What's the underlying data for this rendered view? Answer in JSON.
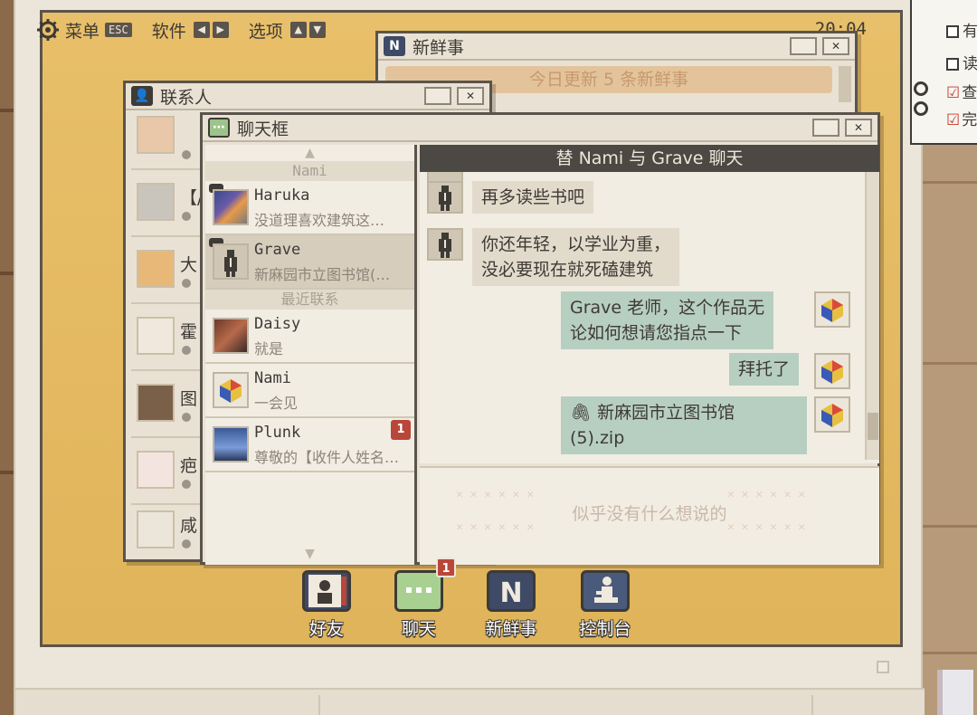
{
  "menubar": {
    "menu_label": "菜单",
    "esc_key": "ESC",
    "software_label": "软件",
    "options_label": "选项",
    "clock": "20:04"
  },
  "news_window": {
    "title": "新鲜事",
    "banner": "今日更新 5 条新鲜事"
  },
  "contacts_window": {
    "title": "联系人",
    "visible_name_fragments": [
      "【/",
      "大",
      "霍",
      "图",
      "疤",
      "咸"
    ]
  },
  "chat_window": {
    "title": "聊天框",
    "header": "替 Nami 与 Grave 聊天",
    "list": {
      "section_nami": "Nami",
      "section_recent": "最近联系",
      "items": [
        {
          "name": "Haruka",
          "preview": "没道理喜欢建筑这…",
          "badge": ""
        },
        {
          "name": "Grave",
          "preview": "新麻园市立图书馆(…",
          "badge": ""
        },
        {
          "name": "Daisy",
          "preview": "就是",
          "badge": ""
        },
        {
          "name": "Nami",
          "preview": "一会见",
          "badge": ""
        },
        {
          "name": "Plunk",
          "preview": "尊敬的【收件人姓名…",
          "badge": "1"
        }
      ]
    },
    "messages": [
      {
        "side": "in",
        "lines": [
          "再多读些书吧"
        ]
      },
      {
        "side": "in",
        "lines": [
          "你还年轻，以学业为重，",
          "没必要现在就死磕建筑"
        ]
      },
      {
        "side": "out",
        "lines": [
          "Grave 老师，这个作品无",
          "论如何想请您指点一下"
        ]
      },
      {
        "side": "out",
        "lines": [
          "拜托了"
        ]
      },
      {
        "side": "out",
        "lines": [
          "新麻园市立图书馆",
          "(5).zip"
        ]
      }
    ],
    "input_placeholder": "似乎没有什么想说的"
  },
  "dock": {
    "items": [
      {
        "label": "好友",
        "icon": "friends-icon",
        "badge": ""
      },
      {
        "label": "聊天",
        "icon": "chat-icon",
        "badge": "1"
      },
      {
        "label": "新鲜事",
        "icon": "news-icon",
        "badge": ""
      },
      {
        "label": "控制台",
        "icon": "console-icon",
        "badge": ""
      }
    ]
  },
  "todo": {
    "items": [
      {
        "text": "有",
        "checked": false
      },
      {
        "text": "读",
        "checked": false
      },
      {
        "text": "查",
        "checked": true
      },
      {
        "text": "完",
        "checked": true
      }
    ]
  },
  "colors": {
    "desktop": "#e3b865",
    "window_bg": "#e9e2d4",
    "frame": "#5a544c",
    "incoming_bubble": "#e2dacb",
    "outgoing_bubble": "#b7cfc0",
    "badge": "#b8473a",
    "header": "#4c4843"
  }
}
